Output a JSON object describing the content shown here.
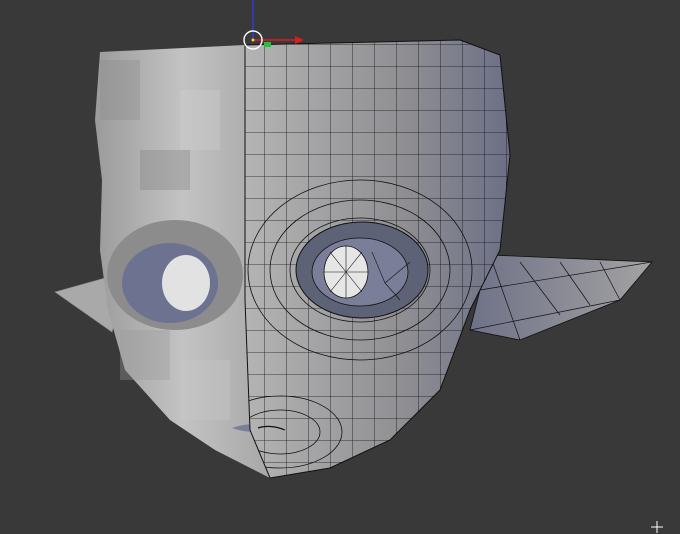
{
  "app": {
    "name": "",
    "view": "3d-viewport"
  },
  "scene": {
    "object": "mesh-head",
    "mode": "edit-mode-wireframe-right-half",
    "mirror_modifier": true
  },
  "colors": {
    "background": "#393939",
    "mesh_light": "#bdbdbd",
    "mesh_mid": "#8a8a8a",
    "mesh_dark": "#6b6b78",
    "mesh_blue_shade": "#6f7390",
    "wire": "#111111",
    "axis_x": "#d81e1e",
    "axis_y": "#22c23a",
    "axis_z": "#2a3fd0",
    "cursor_ring": "#ffffff"
  },
  "icons": {
    "origin": "3d-cursor-origin-icon",
    "crosshair": "crosshair-cursor-icon"
  }
}
